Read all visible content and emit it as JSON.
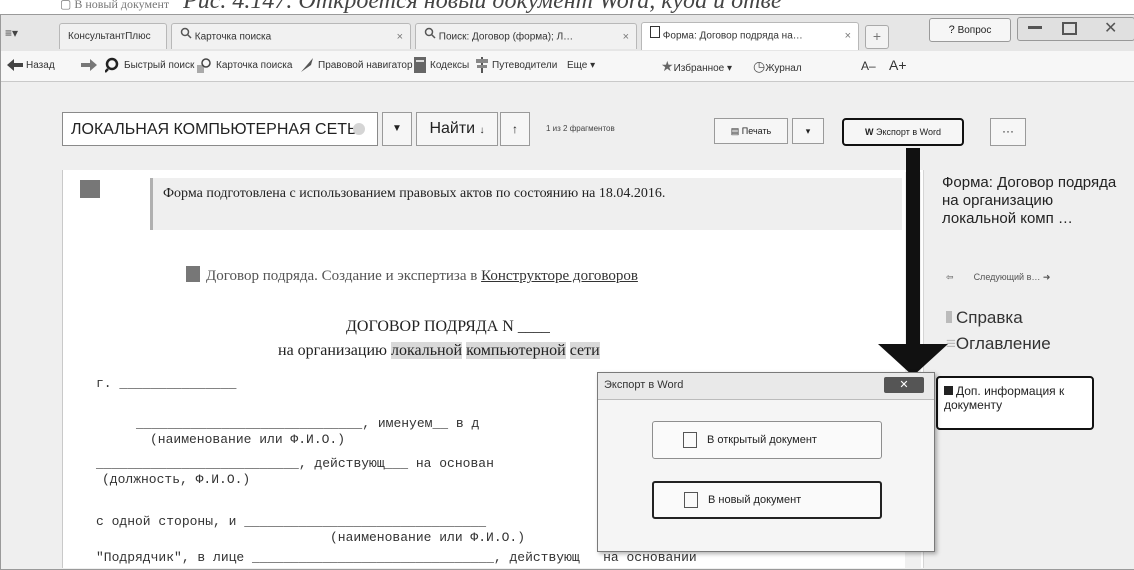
{
  "caption": {
    "prefix": "▢ В новый документ",
    "text": "Рис. 4.147. Откроется новый документ Word, куда и отве"
  },
  "tabs": [
    {
      "label": "КонсультантПлюс"
    },
    {
      "label": "Карточка поиска"
    },
    {
      "label": "Поиск: Договор (форма); Л…"
    },
    {
      "label": "Форма: Договор подряда на…"
    }
  ],
  "window_controls": {
    "question_label": "Вопрос"
  },
  "toolbar": {
    "back": "Назад",
    "quick_search": "Быстрый поиск",
    "search_card": "Карточка поиска",
    "legal_navigator": "Правовой навигатор",
    "codes": "Кодексы",
    "guides": "Путеводители",
    "more": "Еще ▾",
    "favorites": "Избранное ▾",
    "journal": "Журнал",
    "font_minus": "A–",
    "font_plus": "A+"
  },
  "search": {
    "query": "ЛОКАЛЬНАЯ КОМПЬЮТЕРНАЯ СЕТЬ",
    "find": "Найти",
    "fragments": "1 из 2 фрагментов",
    "print": "Печать",
    "export_word": "Экспорт в Word",
    "more": "···"
  },
  "document": {
    "note": "Форма подготовлена с использованием правовых актов по состоянию на 18.04.2016.",
    "constructor_prefix": "Договор подряда. Создание и экспертиза в ",
    "constructor_link": "Конструкторе договоров",
    "title": "ДОГОВОР ПОДРЯДА N ____",
    "subtitle_start": "на организацию ",
    "subtitle_hl1": "локальной",
    "subtitle_hl2": "компьютерной",
    "subtitle_hl3": "сети",
    "line_g": "г. _______________",
    "line1": "_____________________________, именуем__ в д",
    "line1_hint": "(наименование или Ф.И.О.)",
    "line2": "__________________________, действующ___ на основан",
    "line2_hint": "(должность, Ф.И.О.)",
    "line3": "с одной стороны, и _______________________________",
    "line3_hint": "(наименование или Ф.И.О.)",
    "line4": "\"Подрядчик\", в лице _______________________________, действующ   на основании"
  },
  "sidebar": {
    "doc_title": "Форма: Договор подряда на организацию локальной комп …",
    "next_label": "Следующий в…",
    "help": "Справка",
    "contents": "Оглавление",
    "extra_info": "Доп. информация к документу"
  },
  "dialog": {
    "title": "Экспорт в Word",
    "close": "✕",
    "option_open": "В открытый документ",
    "option_new": "В новый документ"
  }
}
